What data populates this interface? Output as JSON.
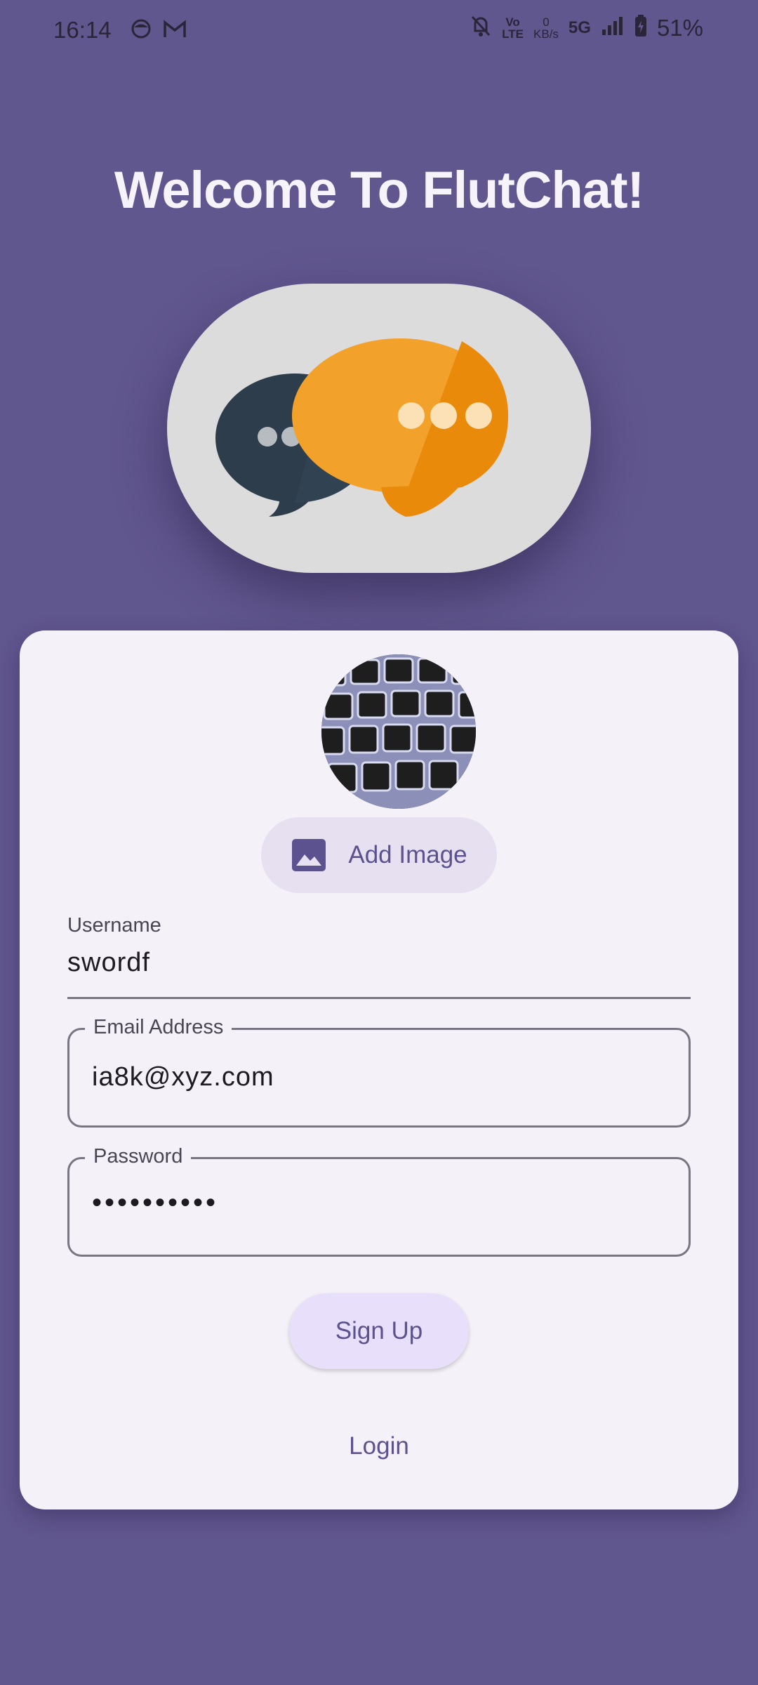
{
  "status_bar": {
    "time": "16:14",
    "network_top": "Vo",
    "network_bottom": "LTE",
    "speed_value": "0",
    "speed_unit": "KB/s",
    "network_type": "5G",
    "battery": "51%"
  },
  "app": {
    "title": "Welcome To FlutChat!"
  },
  "form": {
    "add_image_label": "Add Image",
    "username_label": "Username",
    "username_value": "swordf",
    "email_label": "Email Address",
    "email_value": "ia8k@xyz.com",
    "password_label": "Password",
    "password_value": "••••••••••",
    "signup_label": "Sign Up",
    "login_label": "Login"
  },
  "colors": {
    "background": "#61578f",
    "card": "#f5f1f9",
    "accent": "#5d5290",
    "button_tonal": "#e6e0f0",
    "signup_button": "#e8e0fb"
  }
}
